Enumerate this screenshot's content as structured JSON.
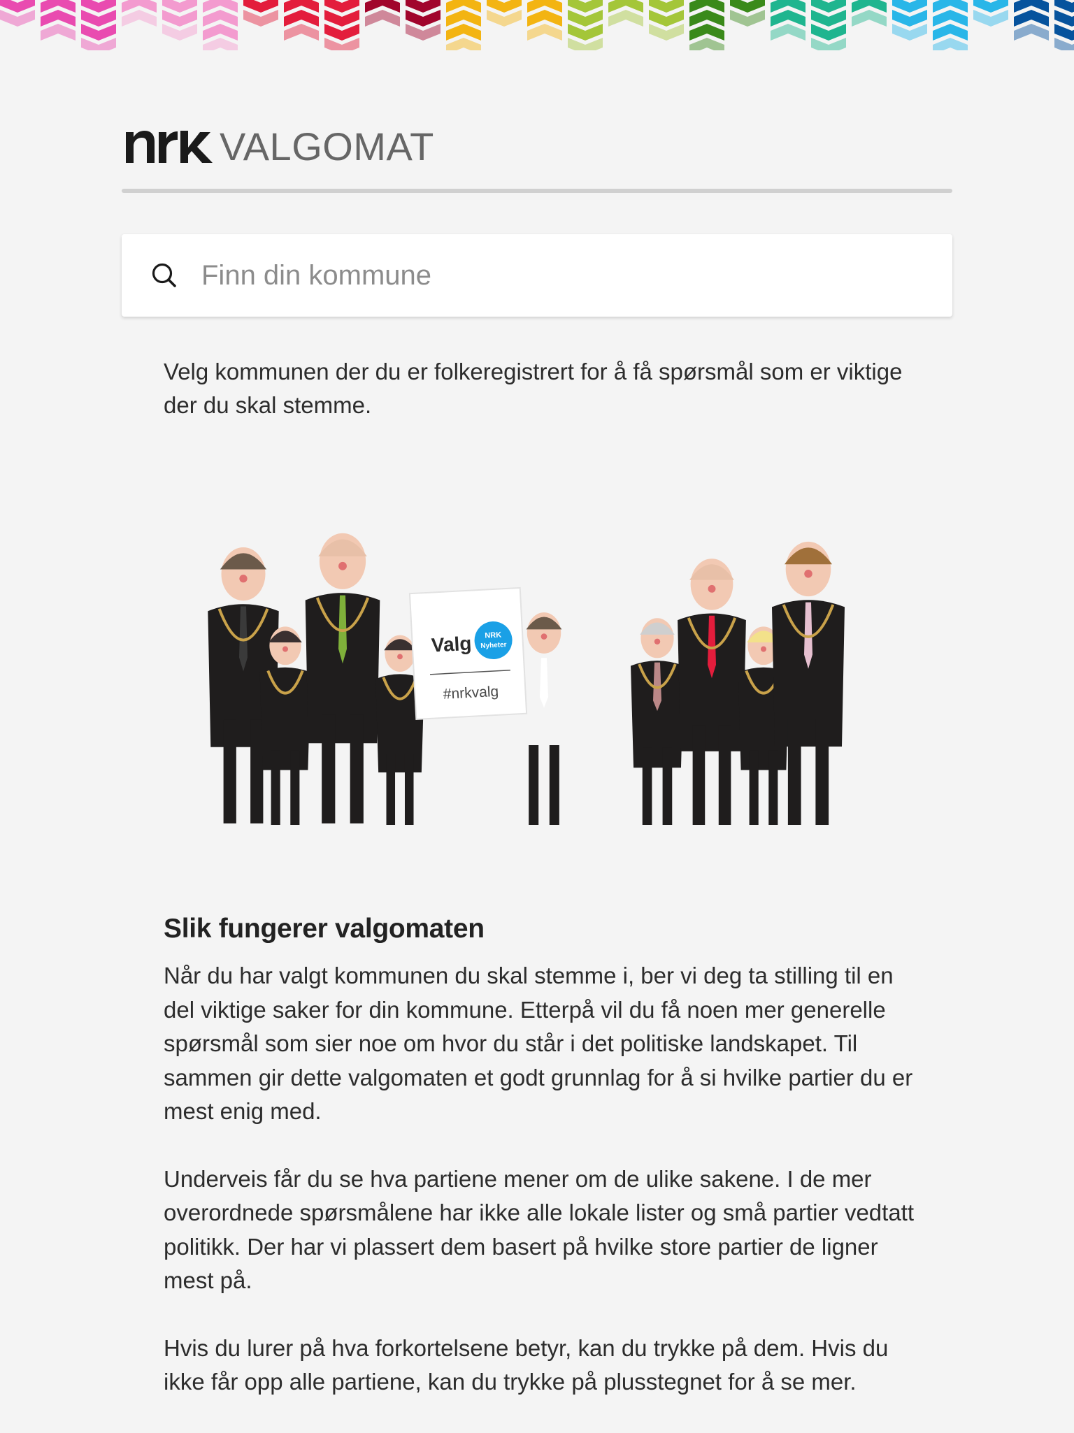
{
  "banner": {
    "colors": [
      "#e94bb0",
      "#f39bcf",
      "#e31d3c",
      "#a1052c",
      "#f3b412",
      "#a4c639",
      "#3a8a1a",
      "#1fb58f",
      "#29b6e8",
      "#06539d"
    ]
  },
  "header": {
    "logo_text": "NRK",
    "title": "VALGOMAT"
  },
  "search": {
    "placeholder": "Finn din kommune",
    "value": ""
  },
  "intro": "Velg kommunen der du er folkeregistrert for å få spørsmål som er viktige der du skal stemme.",
  "illustration": {
    "sign_text": "Valg",
    "sign_badge_line1": "NRK",
    "sign_badge_line2": "Nyheter",
    "sign_hashtag": "#nrkvalg"
  },
  "howto": {
    "title": "Slik fungerer valgomaten",
    "paragraphs": [
      "Når du har valgt kommunen du skal stemme i, ber vi deg ta stilling til en del viktige saker for din kommune. Etterpå vil du få noen mer generelle spørsmål som sier noe om hvor du står i det politiske landskapet. Til sammen gir dette valgomaten et godt grunnlag for å si hvilke partier du er mest enig med.",
      "Underveis får du se hva partiene mener om de ulike sakene. I de mer overordnede spørsmålene har ikke alle lokale lister og små partier vedtatt politikk. Der har vi plassert dem basert på hvilke store partier de ligner mest på.",
      "Hvis du lurer på hva forkortelsene betyr, kan du trykke på dem. Hvis du ikke får opp alle partiene, kan du trykke på plusstegnet for å se mer."
    ]
  }
}
